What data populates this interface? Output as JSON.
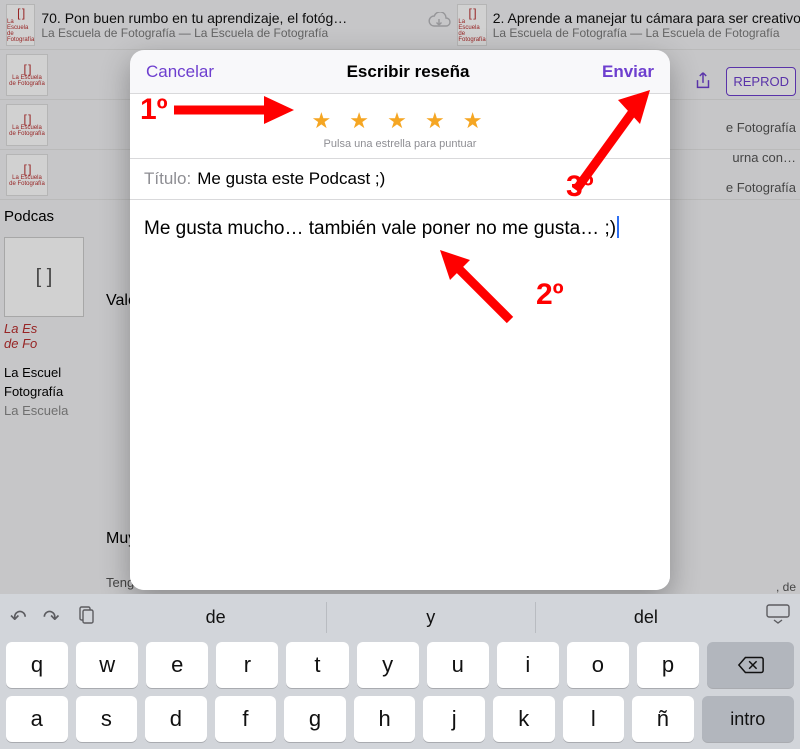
{
  "bg": {
    "row1": {
      "left_title": "70. Pon buen rumbo en tu aprendizaje, el fotóg…",
      "left_sub": "La Escuela de Fotografía — La Escuela de Fotografía",
      "right_title": "2. Aprende a manejar tu cámara para ser creativo",
      "right_sub": "La Escuela de Fotografía — La Escuela de Fotografía"
    },
    "art_line1": "La Escuela",
    "art_line2": "de Fotografía",
    "bracket": "[ ]",
    "podcasts_label": "Podcas",
    "big_label1": "La Es",
    "big_label2": "de Fo",
    "caption1": "La Escuel",
    "caption2": "Fotografía",
    "caption3": "La Escuela",
    "side1": "e Fotografía",
    "side2": "urna con…",
    "side3": "e Fotografía",
    "side_small": ", de",
    "word_valc": "Valc",
    "word_muy": "Muy",
    "word_teng": "Teng",
    "repro": "REPROD"
  },
  "modal": {
    "cancel": "Cancelar",
    "title": "Escribir reseña",
    "send": "Enviar",
    "stars_hint": "Pulsa una estrella para puntuar",
    "title_label": "Título:",
    "title_value": "Me gusta este Podcast ;)",
    "body": "Me gusta mucho… también vale poner no me gusta… ;)"
  },
  "anno": {
    "one": "1º",
    "two": "2º",
    "three": "3º"
  },
  "kb": {
    "sugg": [
      "de",
      "y",
      "del"
    ],
    "row1": [
      "q",
      "w",
      "e",
      "r",
      "t",
      "y",
      "u",
      "i",
      "o",
      "p"
    ],
    "row2": [
      "a",
      "s",
      "d",
      "f",
      "g",
      "h",
      "j",
      "k",
      "l",
      "ñ"
    ],
    "intro": "intro"
  }
}
